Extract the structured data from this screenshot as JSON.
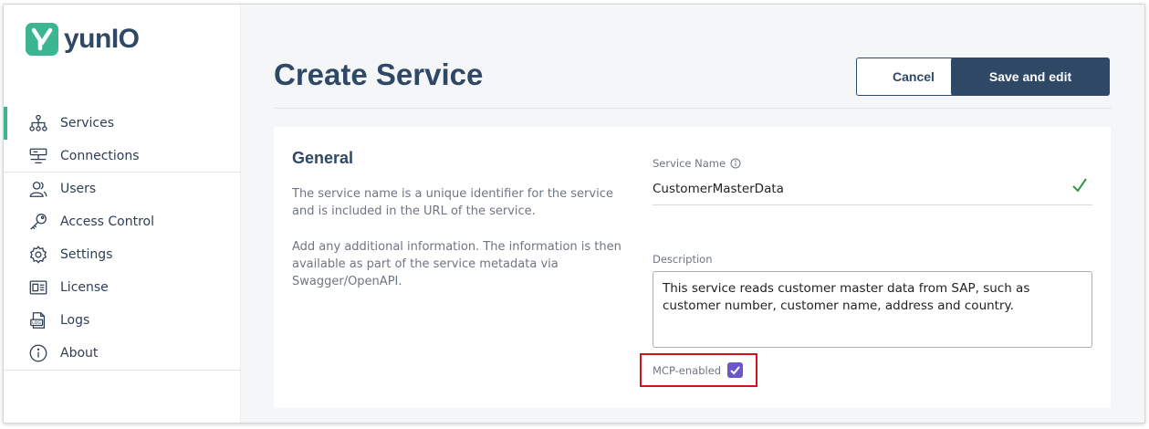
{
  "app": {
    "logo_letter": "y",
    "name": "yunIO",
    "brand_color": "#3cb690",
    "primary_color": "#2f4866"
  },
  "sidebar": {
    "items": [
      {
        "label": "Services",
        "icon": "sitemap-icon",
        "active": true
      },
      {
        "label": "Connections",
        "icon": "server-icon",
        "active": false
      },
      {
        "label": "Users",
        "icon": "users-icon",
        "active": false
      },
      {
        "label": "Access Control",
        "icon": "key-icon",
        "active": false
      },
      {
        "label": "Settings",
        "icon": "gear-icon",
        "active": false
      },
      {
        "label": "License",
        "icon": "id-card-icon",
        "active": false
      },
      {
        "label": "Logs",
        "icon": "log-file-icon",
        "active": false
      },
      {
        "label": "About",
        "icon": "info-icon",
        "active": false
      }
    ]
  },
  "header": {
    "title": "Create Service",
    "cancel_label": "Cancel",
    "save_label": "Save and edit"
  },
  "general": {
    "title": "General",
    "paragraph_1": "The service name is a unique identifier for the service and is included in the URL of the service.",
    "paragraph_2": "Add any additional information. The information is then available as part of the service metadata via Swagger/OpenAPI.",
    "service_name_label": "Service Name",
    "service_name_value": "CustomerMasterData",
    "description_label": "Description",
    "description_value": "This service reads customer master data from SAP, such as customer number, customer name, address and country.",
    "mcp_label": "MCP-enabled",
    "mcp_checked": true,
    "highlight_color": "#d0141b",
    "checkbox_color": "#6b57c9"
  }
}
